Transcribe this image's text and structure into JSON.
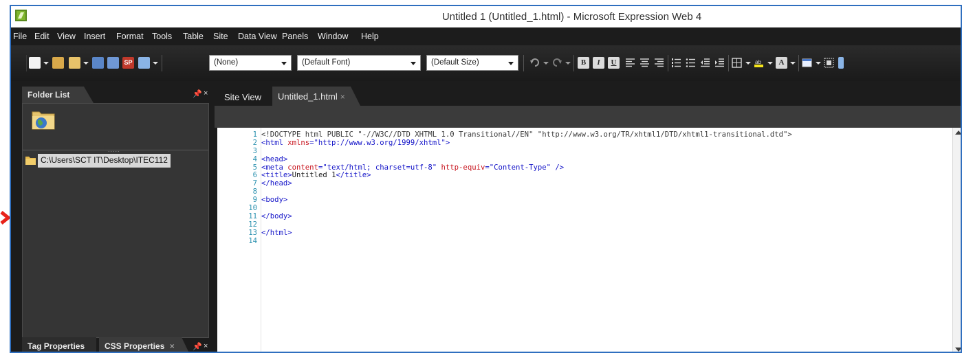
{
  "window": {
    "title": "Untitled 1 (Untitled_1.html) - Microsoft Expression Web 4"
  },
  "menu": [
    "File",
    "Edit",
    "View",
    "Insert",
    "Format",
    "Tools",
    "Table",
    "Site",
    "Data View",
    "Panels",
    "Window",
    "Help"
  ],
  "toolbar": {
    "style_select": "(None)",
    "font_select": "(Default Font)",
    "size_select": "(Default Size)",
    "sp_icon_label": "SP",
    "bold_label": "B",
    "italic_label": "I",
    "underline_label": "U",
    "font_color_label": "A"
  },
  "folder_panel": {
    "tab_label": "Folder List",
    "path": "C:\\Users\\SCT IT\\Desktop\\ITEC112",
    "splitter": "....."
  },
  "bottom_tabs": {
    "tag_properties": "Tag Properties",
    "css_properties": "CSS Properties",
    "css_close": "×"
  },
  "panel_controls": {
    "pin": "▾",
    "close": "×"
  },
  "doc_tabs": {
    "site_view": "Site View",
    "active": "Untitled_1.html",
    "close": "×"
  },
  "code": {
    "line_numbers": [
      "1",
      "2",
      "3",
      "4",
      "5",
      "6",
      "7",
      "8",
      "9",
      "10",
      "11",
      "12",
      "13",
      "14"
    ],
    "lines": [
      "<!DOCTYPE html PUBLIC \"-//W3C//DTD XHTML 1.0 Transitional//EN\" \"http://www.w3.org/TR/xhtml1/DTD/xhtml1-transitional.dtd\">",
      "<html xmlns=\"http://www.w3.org/1999/xhtml\">",
      "",
      "<head>",
      "<meta content=\"text/html; charset=utf-8\" http-equiv=\"Content-Type\" />",
      "<title>Untitled 1</title>",
      "</head>",
      "",
      "<body>",
      "",
      "</body>",
      "",
      "</html>",
      ""
    ]
  },
  "colors": {
    "accent_border": "#2f6fbf",
    "arrow": "#e8231a",
    "tag": "#1414c8",
    "attribute": "#c8141e"
  }
}
